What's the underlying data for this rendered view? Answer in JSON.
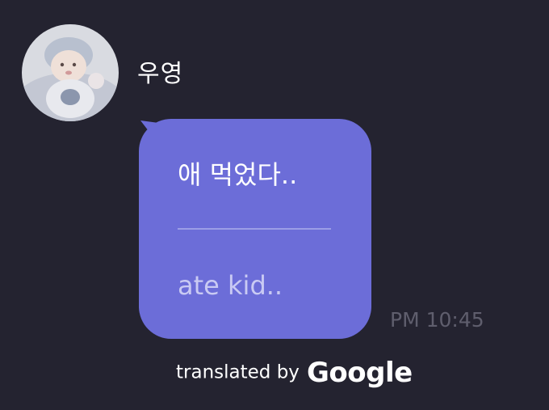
{
  "message": {
    "sender": "우영",
    "avatar": "baby-photo-avatar",
    "original_text": "애 먹었다..",
    "translated_text": "ate kid..",
    "timestamp": "PM 10:45"
  },
  "attribution": {
    "prefix": "translated by",
    "brand": "Google"
  },
  "colors": {
    "background": "#242330",
    "bubble": "#6c6dd8",
    "translated_text": "#c9caf3",
    "timestamp": "#5f5e6d"
  }
}
